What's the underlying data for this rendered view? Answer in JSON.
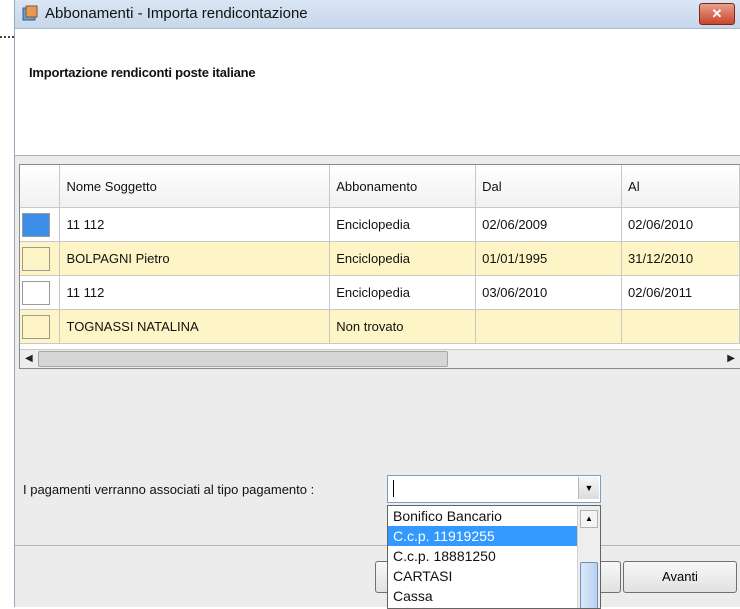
{
  "window": {
    "title": "Abbonamenti - Importa rendicontazione",
    "close_label": "✕"
  },
  "header": {
    "title": "Importazione rendiconti poste italiane"
  },
  "table": {
    "columns": [
      "",
      "Nome Soggetto",
      "Abbonamento",
      "Dal",
      "Al"
    ],
    "rows": [
      {
        "nome": "11 112",
        "abbonamento": "Enciclopedia",
        "dal": "02/06/2009",
        "al": "02/06/2010",
        "highlight": false,
        "selector_color": "#3d8ee8"
      },
      {
        "nome": "BOLPAGNI Pietro",
        "abbonamento": "Enciclopedia",
        "dal": "01/01/1995",
        "al": "31/12/2010",
        "highlight": true,
        "selector_color": "#fdf5c6"
      },
      {
        "nome": "11 112",
        "abbonamento": "Enciclopedia",
        "dal": "03/06/2010",
        "al": "02/06/2011",
        "highlight": false,
        "selector_color": "#ffffff"
      },
      {
        "nome": "TOGNASSI NATALINA",
        "abbonamento": "Non trovato",
        "dal": "",
        "al": "",
        "highlight": true,
        "selector_color": "#fdf5c6"
      }
    ]
  },
  "payment": {
    "label": "I pagamenti verranno associati al tipo pagamento :",
    "value": "",
    "options": [
      "Bonifico Bancario",
      "C.c.p. 11919255",
      "C.c.p. 18881250",
      "CARTASI",
      "Cassa"
    ],
    "highlighted_option": "C.c.p. 11919255"
  },
  "buttons": {
    "next_label": "Avanti"
  },
  "colors": {
    "row_highlight": "#fdf5c6",
    "selection": "#3399ff"
  }
}
